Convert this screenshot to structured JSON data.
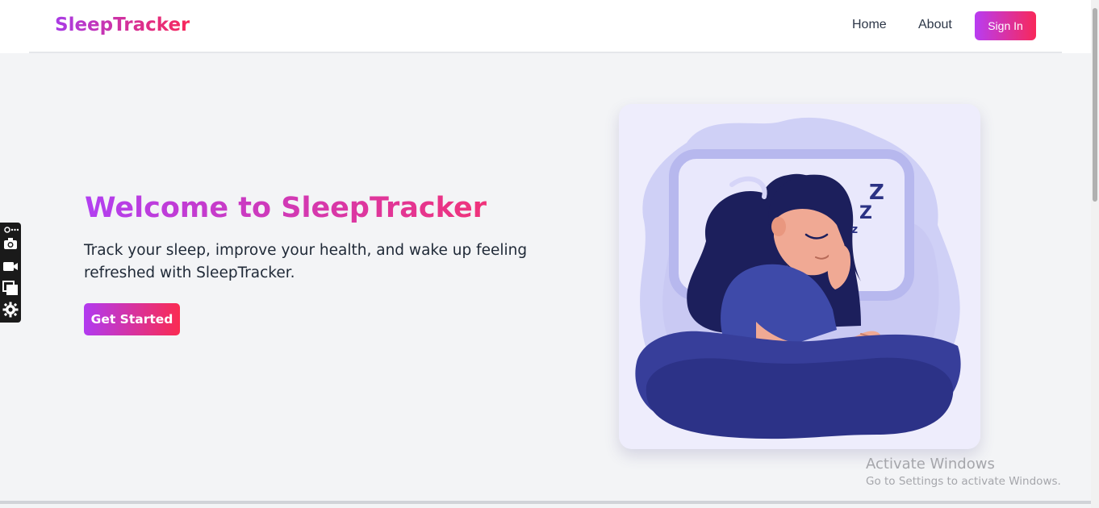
{
  "nav": {
    "brand": "SleepTracker",
    "links": [
      {
        "label": "Home"
      },
      {
        "label": "About"
      }
    ],
    "signin_label": "Sign In"
  },
  "hero": {
    "title": "Welcome to SleepTracker",
    "subtitle": "Track your sleep, improve your health, and wake up feeling refreshed with SleepTracker.",
    "cta_label": "Get Started"
  },
  "illustration": {
    "description_icon": "sleeping-woman-illustration",
    "zzz": [
      "Z",
      "Z",
      "z"
    ]
  },
  "toolbar": {
    "icons": [
      "link-icon",
      "camera-icon",
      "video-icon",
      "windows-icon",
      "gear-icon"
    ]
  },
  "watermark": {
    "title": "Activate Windows",
    "subtitle": "Go to Settings to activate Windows."
  },
  "colors": {
    "brand_gradient_start": "#b23ff1",
    "brand_gradient_end": "#f8285a",
    "background": "#f3f4f6",
    "navy": "#1e2358",
    "blanket": "#3a3f94"
  }
}
